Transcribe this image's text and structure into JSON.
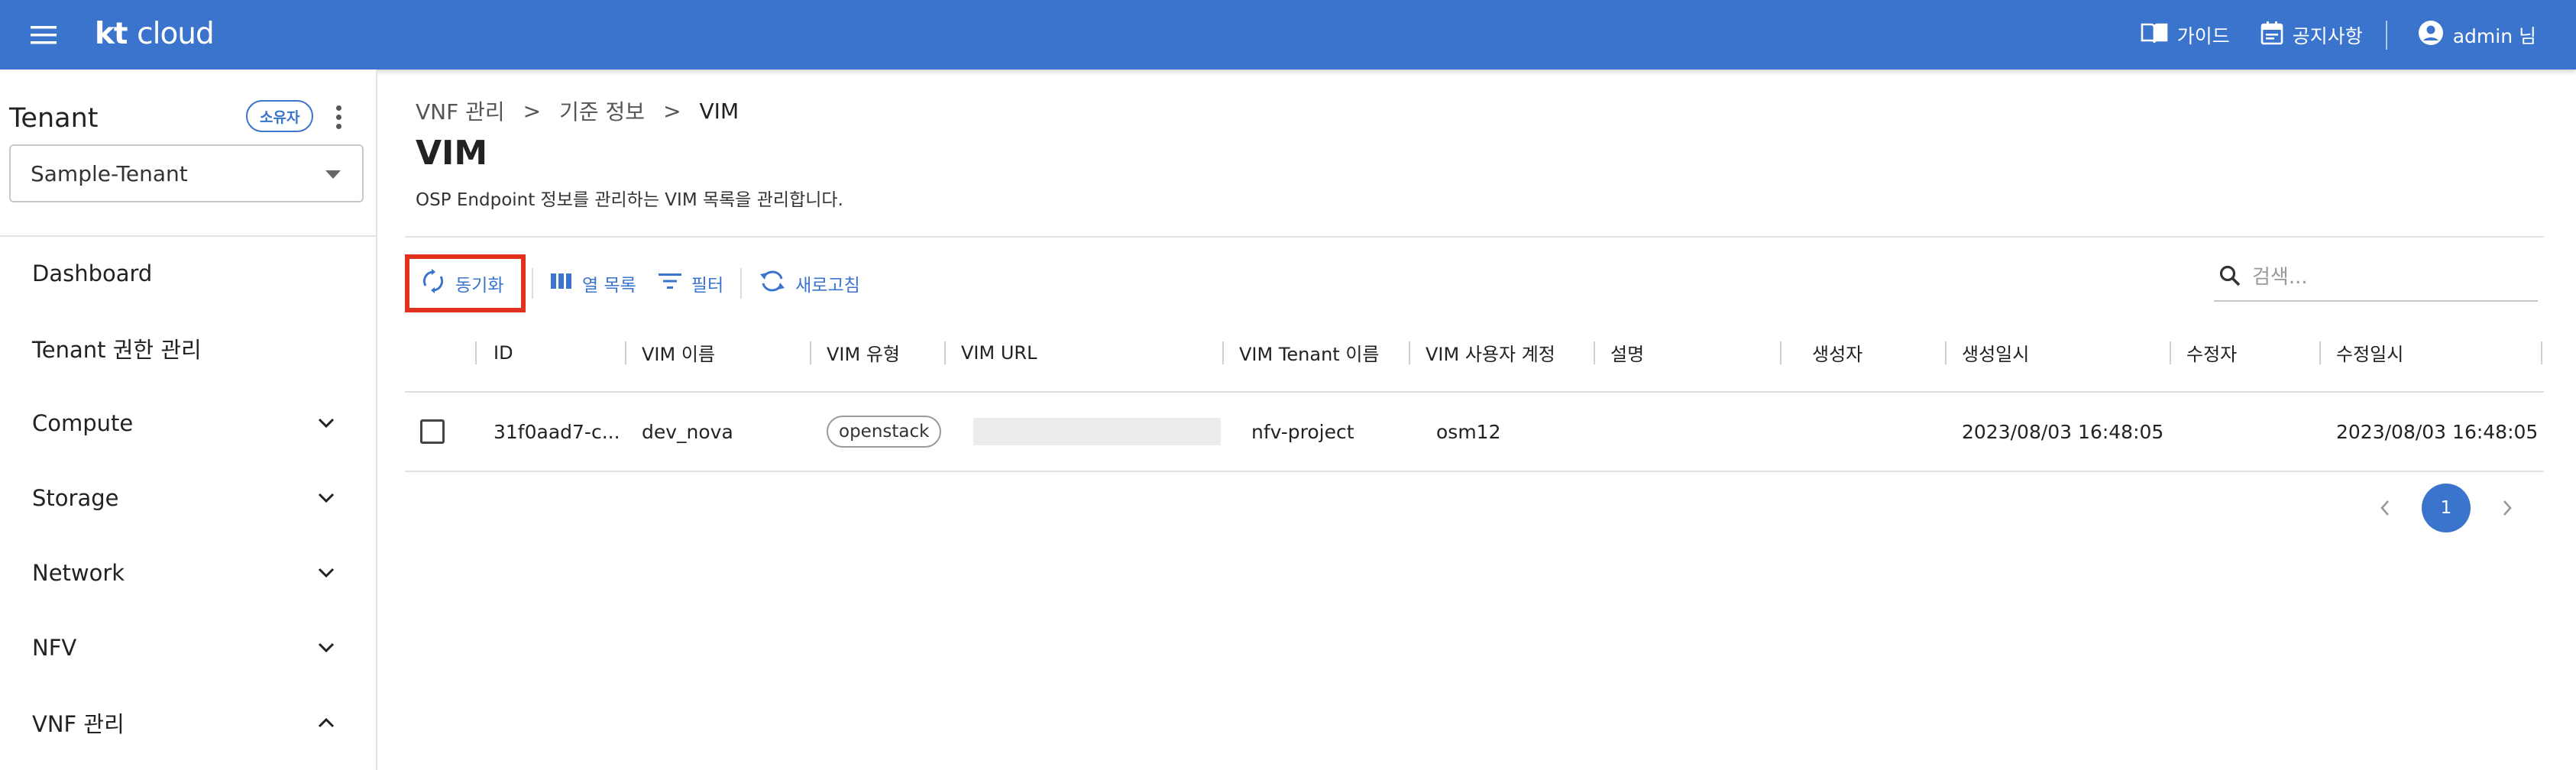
{
  "header": {
    "logo_kt": "kt",
    "logo_cloud": "cloud",
    "menu_icon": "hamburger-icon",
    "guide_label": "가이드",
    "notice_label": "공지사항",
    "user_label": "admin 님",
    "brand_color": "#3a74cc"
  },
  "sidebar": {
    "tenant_title": "Tenant",
    "owner_badge": "소유자",
    "tenant_selected": "Sample-Tenant",
    "items": [
      {
        "label": "Dashboard",
        "chevron": ""
      },
      {
        "label": "Tenant 권한 관리",
        "chevron": ""
      },
      {
        "label": "Compute",
        "chevron": "chevron-down-icon"
      },
      {
        "label": "Storage",
        "chevron": "chevron-down-icon"
      },
      {
        "label": "Network",
        "chevron": "chevron-down-icon"
      },
      {
        "label": "NFV",
        "chevron": "chevron-down-icon"
      },
      {
        "label": "VNF 관리",
        "chevron": "chevron-up-icon"
      }
    ]
  },
  "breadcrumb": [
    "VNF 관리",
    "기준 정보",
    "VIM"
  ],
  "breadcrumb_separator": ">",
  "page": {
    "title": "VIM",
    "description": "OSP Endpoint 정보를 관리하는 VIM 목록을 관리합니다."
  },
  "toolbar": {
    "sync_label": "동기화",
    "columns_label": "열 목록",
    "filter_label": "필터",
    "refresh_label": "새로고침",
    "highlight_color": "#e0321e"
  },
  "search": {
    "placeholder": "검색..."
  },
  "table": {
    "headers": [
      "ID",
      "VIM 이름",
      "VIM 유형",
      "VIM URL",
      "VIM Tenant 이름",
      "VIM 사용자 계정",
      "설명",
      "생성자",
      "생성일시",
      "수정자",
      "수정일시"
    ],
    "rows": [
      {
        "id": "31f0aad7-c...",
        "name": "dev_nova",
        "type": "openstack",
        "url": "",
        "tenant": "nfv-project",
        "user": "osm12",
        "desc": "",
        "creator": "",
        "created_at": "2023/08/03 16:48:05",
        "modifier": "",
        "modified_at": "2023/08/03 16:48:05"
      }
    ]
  },
  "pagination": {
    "current_page": "1"
  }
}
